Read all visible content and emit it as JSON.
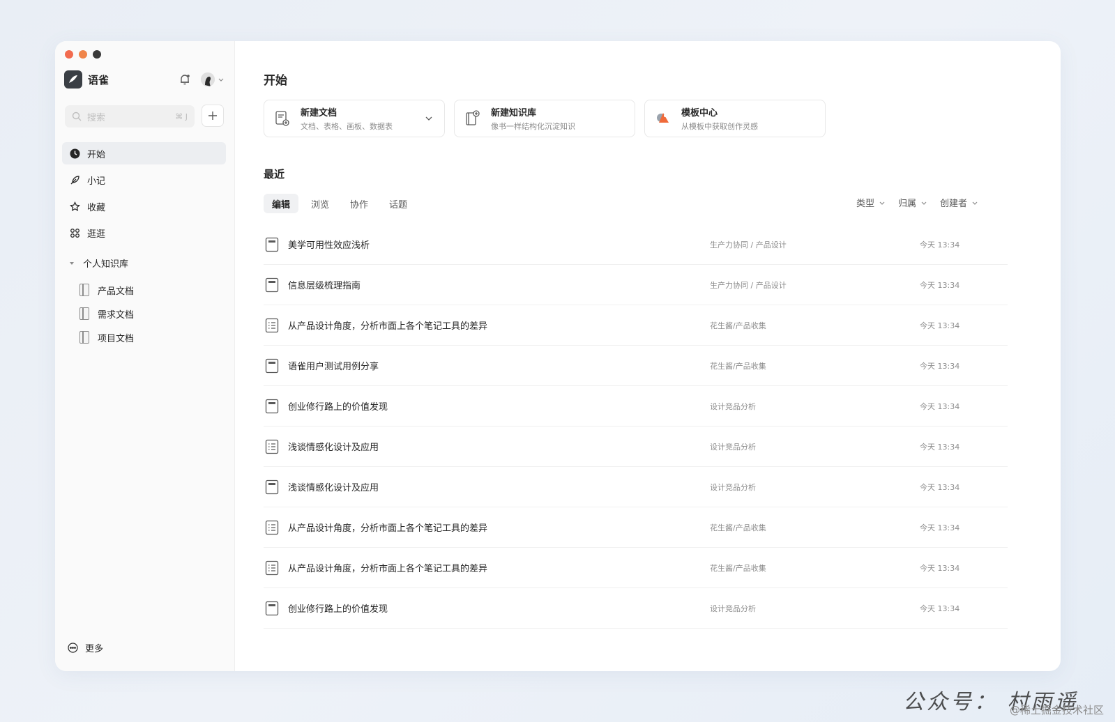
{
  "app": {
    "name": "语雀"
  },
  "sidebar": {
    "search_placeholder": "搜索",
    "search_shortcut": "⌘ J",
    "nav": [
      {
        "label": "开始",
        "icon": "clock-icon",
        "active": true
      },
      {
        "label": "小记",
        "icon": "feather-icon",
        "active": false
      },
      {
        "label": "收藏",
        "icon": "star-icon",
        "active": false
      },
      {
        "label": "逛逛",
        "icon": "command-icon",
        "active": false
      }
    ],
    "knowledge_base_header": "个人知识库",
    "knowledge_bases": [
      {
        "label": "产品文档"
      },
      {
        "label": "需求文档"
      },
      {
        "label": "项目文档"
      }
    ],
    "more_label": "更多"
  },
  "main": {
    "title": "开始",
    "cards": [
      {
        "title": "新建文档",
        "subtitle": "文档、表格、画板、数据表"
      },
      {
        "title": "新建知识库",
        "subtitle": "像书一样结构化沉淀知识"
      },
      {
        "title": "模板中心",
        "subtitle": "从模板中获取创作灵感"
      }
    ],
    "recent_title": "最近",
    "tabs": [
      {
        "label": "编辑",
        "active": true
      },
      {
        "label": "浏览",
        "active": false
      },
      {
        "label": "协作",
        "active": false
      },
      {
        "label": "话题",
        "active": false
      }
    ],
    "filters": [
      {
        "label": "类型"
      },
      {
        "label": "归属"
      },
      {
        "label": "创建者"
      }
    ],
    "docs": [
      {
        "title": "美学可用性效应浅析",
        "path": "生产力协同 / 产品设计",
        "time": "今天 13:34",
        "icon": "doc"
      },
      {
        "title": "信息层级梳理指南",
        "path": "生产力协同 / 产品设计",
        "time": "今天 13:34",
        "icon": "doc"
      },
      {
        "title": "从产品设计角度，分析市面上各个笔记工具的差异",
        "path": "花生酱/产品收集",
        "time": "今天 13:34",
        "icon": "sheet"
      },
      {
        "title": "语雀用户测试用例分享",
        "path": "花生酱/产品收集",
        "time": "今天 13:34",
        "icon": "doc"
      },
      {
        "title": "创业修行路上的价值发现",
        "path": "设计竞品分析",
        "time": "今天 13:34",
        "icon": "doc"
      },
      {
        "title": "浅谈情感化设计及应用",
        "path": "设计竞品分析",
        "time": "今天 13:34",
        "icon": "sheet"
      },
      {
        "title": "浅谈情感化设计及应用",
        "path": "设计竞品分析",
        "time": "今天 13:34",
        "icon": "doc"
      },
      {
        "title": "从产品设计角度，分析市面上各个笔记工具的差异",
        "path": "花生酱/产品收集",
        "time": "今天 13:34",
        "icon": "sheet"
      },
      {
        "title": "从产品设计角度，分析市面上各个笔记工具的差异",
        "path": "花生酱/产品收集",
        "time": "今天 13:34",
        "icon": "sheet"
      },
      {
        "title": "创业修行路上的价值发现",
        "path": "设计竞品分析",
        "time": "今天 13:34",
        "icon": "doc"
      }
    ]
  },
  "watermark": {
    "text": "公众号： 村雨遥",
    "sub": "@稀土掘金技术社区"
  },
  "colors": {
    "traffic_red": "#f26b4f",
    "traffic_orange": "#f0854a",
    "traffic_dark": "#3a3a3a",
    "accent_orange": "#f06a3a"
  }
}
